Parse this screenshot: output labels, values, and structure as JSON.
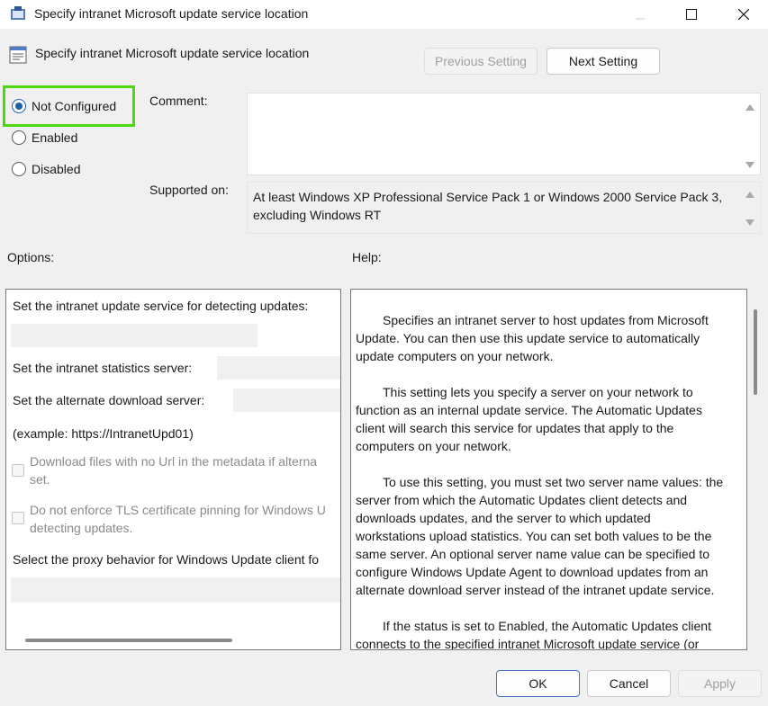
{
  "window": {
    "title": "Specify intranet Microsoft update service location"
  },
  "header": {
    "title": "Specify intranet Microsoft update service location",
    "previous_label": "Previous Setting",
    "next_label": "Next Setting"
  },
  "state": {
    "options": [
      "Not Configured",
      "Enabled",
      "Disabled"
    ],
    "selected": "Not Configured"
  },
  "comment": {
    "label": "Comment:",
    "value": ""
  },
  "supported": {
    "label": "Supported on:",
    "value": "At least Windows XP Professional Service Pack 1 or Windows 2000 Service Pack 3, excluding Windows RT",
    "line1": "At least Windows XP Professional Service Pack 1 or Windows 2000 Service Pack 3,",
    "line2": "excluding Windows RT"
  },
  "options_pane": {
    "heading": "Options:",
    "detect_label": "Set the intranet update service for detecting updates:",
    "stats_label": "Set the intranet statistics server:",
    "alt_label": "Set the alternate download server:",
    "example": "(example: https://IntranetUpd01)",
    "chk1_line1": "Download files with no Url in the metadata if alterna",
    "chk1_line2": "set.",
    "chk2_line1": "Do not enforce TLS certificate pinning for Windows U",
    "chk2_line2": "detecting updates.",
    "proxy_label": "Select the proxy behavior for Windows Update client fo"
  },
  "help_pane": {
    "heading": "Help:",
    "p1_l1": "Specifies an intranet server to host updates from Microsoft",
    "p1_l2": "Update. You can then use this update service to automatically",
    "p1_l3": "update computers on your network.",
    "p2_l1": "This setting lets you specify a server on your network to",
    "p2_l2": "function as an internal update service. The Automatic Updates",
    "p2_l3": "client will search this service for updates that apply to the",
    "p2_l4": "computers on your network.",
    "p3_l1": "To use this setting, you must set two server name values: the",
    "p3_l2": "server from which the Automatic Updates client detects and",
    "p3_l3": "downloads updates, and the server to which updated",
    "p3_l4": "workstations upload statistics. You can set both values to be the",
    "p3_l5": "same server. An optional server name value can be specified to",
    "p3_l6": "configure Windows Update Agent to download updates from an",
    "p3_l7": "alternate download server instead of the intranet update service.",
    "p4_l1": "If the status is set to Enabled, the Automatic Updates client",
    "p4_l2": "connects to the specified intranet Microsoft update service (or"
  },
  "footer": {
    "ok_label": "OK",
    "cancel_label": "Cancel",
    "apply_label": "Apply"
  },
  "colors": {
    "highlight": "#4cd90f",
    "radio_selected": "#1f5fa8",
    "default_button_border": "#4a74b8"
  }
}
